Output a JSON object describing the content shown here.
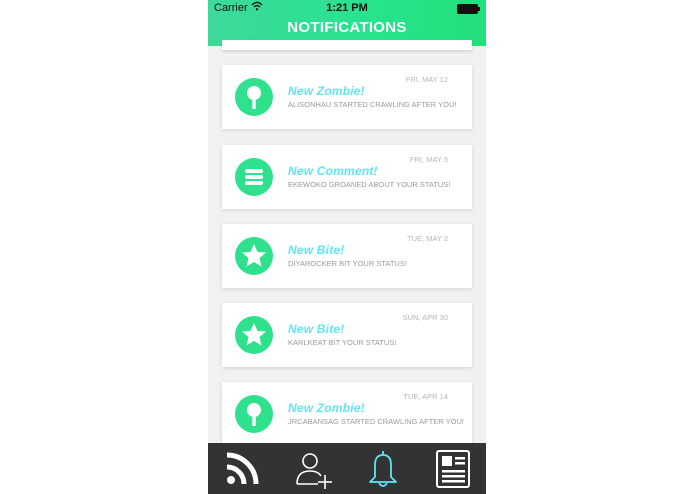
{
  "status_bar": {
    "carrier": "Carrier",
    "time": "1:21 PM"
  },
  "header": {
    "title": "NOTIFICATIONS"
  },
  "notifications": [
    {
      "type": "New Zombie!",
      "icon": "pin-icon",
      "description": "ALISONHAU STARTED CRAWLING AFTER YOU!",
      "date": "FRI, MAY 12"
    },
    {
      "type": "New Comment!",
      "icon": "menu-lines-icon",
      "description": "EKEWOKO GROANED ABOUT YOUR STATUS!",
      "date": "FRI, MAY 5"
    },
    {
      "type": "New Bite!",
      "icon": "star-icon",
      "description": "DIYAROCKER BIT YOUR STATUS!",
      "date": "TUE, MAY 2"
    },
    {
      "type": "New Bite!",
      "icon": "star-icon",
      "description": "KARLKEAT BIT YOUR STATUS!",
      "date": "SUN, APR 30"
    },
    {
      "type": "New Zombie!",
      "icon": "pin-icon",
      "description": "JRCABANSAG STARTED CRAWLING AFTER YOU!",
      "date": "TUE, APR 14"
    }
  ],
  "tab_bar": [
    {
      "name": "feed",
      "icon": "rss-icon"
    },
    {
      "name": "add-friend",
      "icon": "add-user-icon"
    },
    {
      "name": "notifications",
      "icon": "bell-icon",
      "active": true
    },
    {
      "name": "profile",
      "icon": "profile-card-icon"
    }
  ],
  "colors": {
    "accent_green": "#2fe18d",
    "title_cyan": "#5ee6f4",
    "tab_bar": "#333333",
    "active_tab": "#5ee6f4"
  }
}
